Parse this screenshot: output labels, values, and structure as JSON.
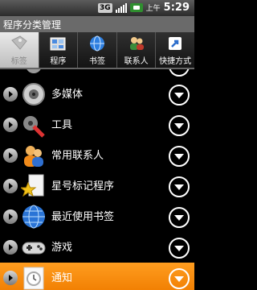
{
  "status": {
    "network": "3G",
    "ampm": "上午",
    "time": "5:29"
  },
  "title": "程序分类管理",
  "tabs": [
    {
      "label": "标签",
      "icon": "tag-icon",
      "active": true
    },
    {
      "label": "程序",
      "icon": "apps-icon",
      "active": false
    },
    {
      "label": "书签",
      "icon": "globe-icon",
      "active": false
    },
    {
      "label": "联系人",
      "icon": "contacts-icon",
      "active": false
    },
    {
      "label": "快捷方式",
      "icon": "shortcut-icon",
      "active": false
    }
  ],
  "rows": [
    {
      "label": "",
      "icon": "gear-icon"
    },
    {
      "label": "多媒体",
      "icon": "speaker-icon"
    },
    {
      "label": "工具",
      "icon": "tools-icon"
    },
    {
      "label": "常用联系人",
      "icon": "people-icon"
    },
    {
      "label": "星号标记程序",
      "icon": "star-doc-icon"
    },
    {
      "label": "最近使用书签",
      "icon": "globe-icon"
    },
    {
      "label": "游戏",
      "icon": "gamepad-icon"
    },
    {
      "label": "通知",
      "icon": "clock-icon",
      "selected": true
    }
  ],
  "colors": {
    "selection": "#f58a00",
    "active_tab": "#d0d0d0"
  }
}
